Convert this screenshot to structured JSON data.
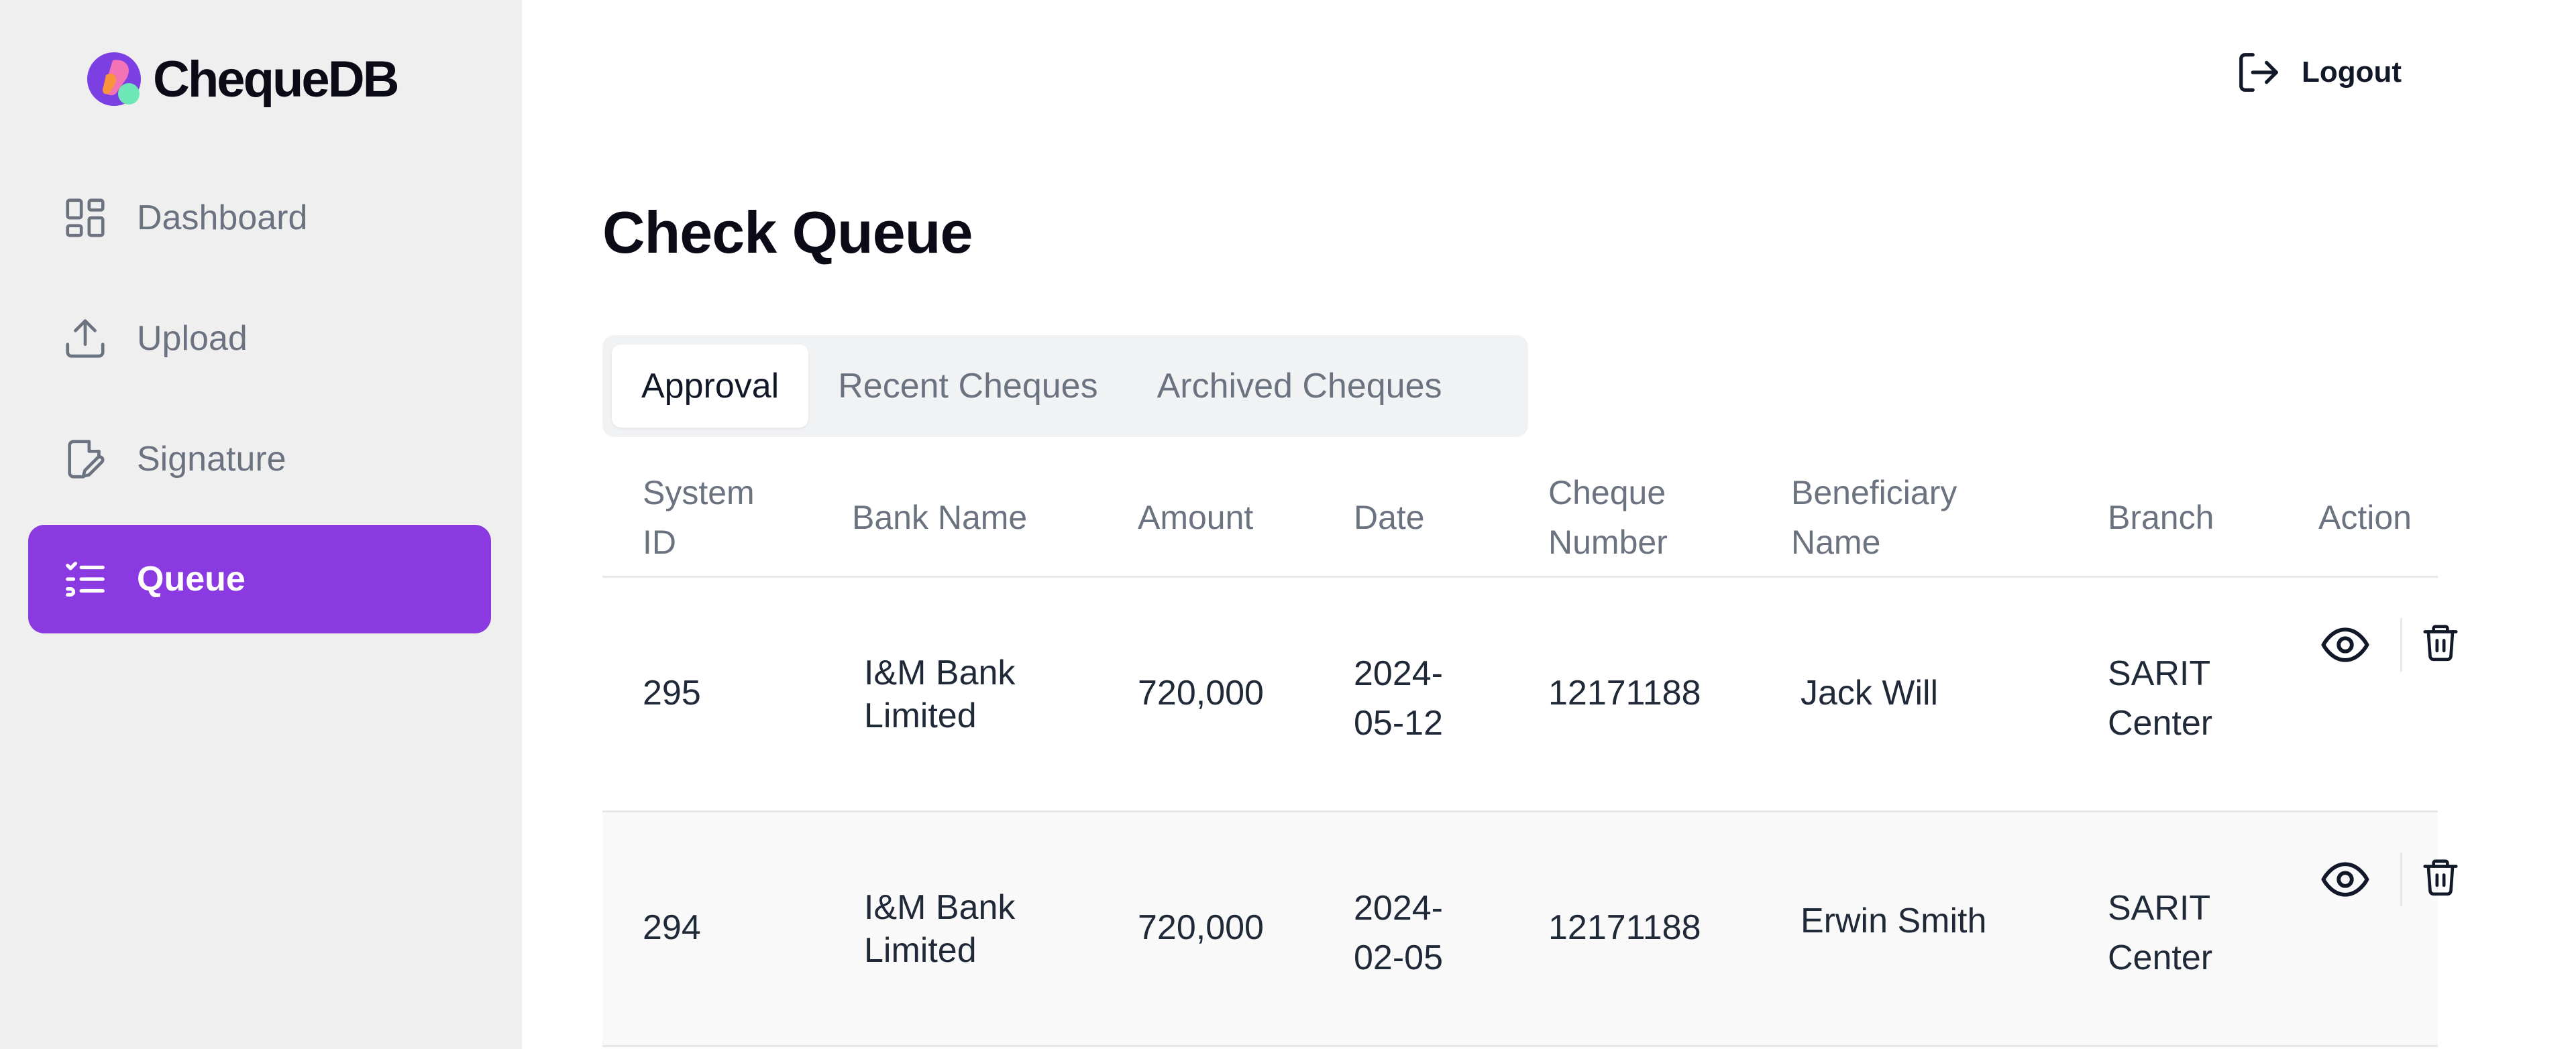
{
  "app": {
    "name": "ChequeDB",
    "colors": {
      "accent": "#8a3ae0",
      "logo_purple": "#7b3fe4",
      "logo_pink": "#f472b6",
      "logo_orange": "#fb923c",
      "logo_green": "#6ee7b7"
    }
  },
  "sidebar": {
    "items": [
      {
        "label": "Dashboard",
        "icon": "dashboard-icon",
        "active": false
      },
      {
        "label": "Upload",
        "icon": "upload-icon",
        "active": false
      },
      {
        "label": "Signature",
        "icon": "signature-icon",
        "active": false
      },
      {
        "label": "Queue",
        "icon": "queue-list-icon",
        "active": true
      }
    ]
  },
  "header": {
    "logout_label": "Logout",
    "logout_icon": "logout-icon"
  },
  "main": {
    "title": "Check Queue",
    "tabs": [
      {
        "label": "Approval",
        "active": true
      },
      {
        "label": "Recent Cheques",
        "active": false
      },
      {
        "label": "Archived Cheques",
        "active": false
      }
    ],
    "table": {
      "headers": {
        "system_id": [
          "System",
          "ID"
        ],
        "bank_name": [
          "Bank Name"
        ],
        "amount": [
          "Amount"
        ],
        "date": [
          "Date"
        ],
        "cheque_number": [
          "Cheque",
          "Number"
        ],
        "beneficiary": [
          "Beneficiary",
          "Name"
        ],
        "branch": [
          "Branch"
        ],
        "action": [
          "Action"
        ]
      },
      "rows": [
        {
          "system_id": "295",
          "bank_name": [
            "I&M Bank",
            "Limited"
          ],
          "amount": "720,000",
          "date": [
            "2024-",
            "05-12"
          ],
          "cheque_number": "12171188",
          "beneficiary": "Jack Will",
          "branch": [
            "SARIT",
            "Center"
          ]
        },
        {
          "system_id": "294",
          "bank_name": [
            "I&M Bank",
            "Limited"
          ],
          "amount": "720,000",
          "date": [
            "2024-",
            "02-05"
          ],
          "cheque_number": "12171188",
          "beneficiary": "Erwin Smith",
          "branch": [
            "SARIT",
            "Center"
          ]
        }
      ],
      "action_icons": [
        "eye-icon",
        "trash-icon"
      ]
    }
  }
}
